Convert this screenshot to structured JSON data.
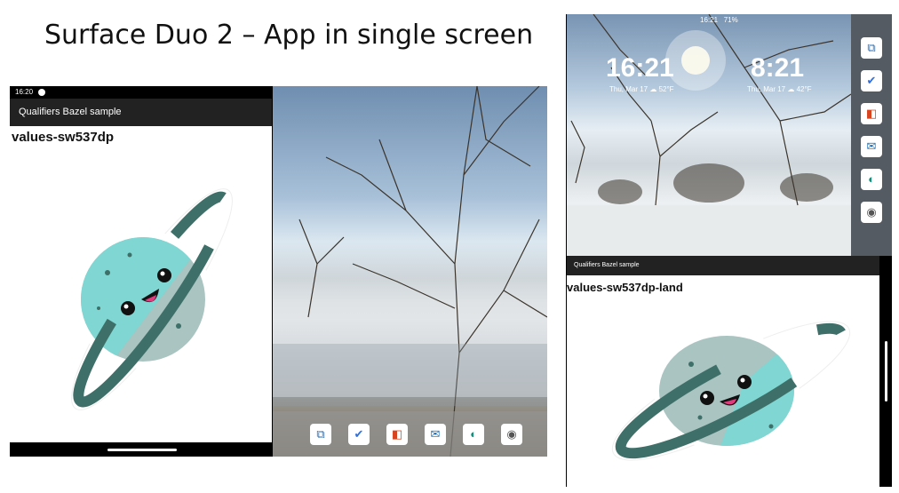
{
  "slide": {
    "title": "Surface Duo 2 – App in single screen"
  },
  "left_device": {
    "status_time": "16:20",
    "app_title": "Qualifiers Bazel sample",
    "qualifier_label": "values-sw537dp",
    "dock_icons": [
      "dual-screen-icon",
      "todo-icon",
      "office-icon",
      "outlook-icon",
      "edge-icon",
      "camera-icon"
    ]
  },
  "right_device": {
    "status_time": "16:21",
    "battery": "71%",
    "clock_left": "16:21",
    "date_left": "Thu, Mar 17 ☁ 52°F",
    "clock_right": "8:21",
    "date_right": "Thu, Mar 17 ☁ 42°F",
    "app_title": "Qualifiers Bazel sample",
    "qualifier_label": "values-sw537dp-land",
    "rail_icons": [
      "dual-screen-icon",
      "todo-icon",
      "office-icon",
      "outlook-icon",
      "edge-icon",
      "camera-icon"
    ]
  },
  "colors": {
    "planet_teal": "#7fd6d2",
    "planet_gray": "#a9c4c1",
    "ring": "#3e6f68",
    "cheek": "#e13c7d"
  }
}
